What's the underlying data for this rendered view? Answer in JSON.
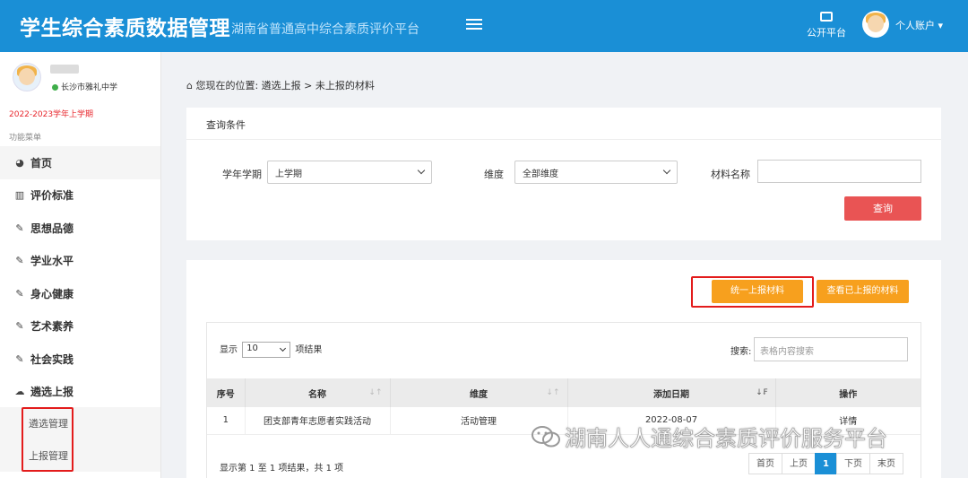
{
  "header": {
    "title": "学生综合素质数据管理",
    "subtitle": "湖南省普通高中综合素质评价平台",
    "public_label": "公开平台",
    "account_label": "个人账户"
  },
  "sidebar": {
    "school": "长沙市雅礼中学",
    "semester": "2022-2023学年上学期",
    "menu_title": "功能菜单",
    "items": [
      {
        "label": "首页",
        "icon": "dashboard-icon"
      },
      {
        "label": "评价标准",
        "icon": "map-icon"
      },
      {
        "label": "思想品德",
        "icon": "edit-icon"
      },
      {
        "label": "学业水平",
        "icon": "edit-icon"
      },
      {
        "label": "身心健康",
        "icon": "edit-icon"
      },
      {
        "label": "艺术素养",
        "icon": "edit-icon"
      },
      {
        "label": "社会实践",
        "icon": "edit-icon"
      },
      {
        "label": "遴选上报",
        "icon": "cloud-upload-icon"
      }
    ],
    "subitems": [
      {
        "label": "遴选管理"
      },
      {
        "label": "上报管理"
      }
    ]
  },
  "breadcrumb": "您现在的位置: 遴选上报 > 未上报的材料",
  "query": {
    "title": "查询条件",
    "term_label": "学年学期",
    "term_value": "上学期",
    "dimension_label": "维度",
    "dimension_value": "全部维度",
    "material_label": "材料名称",
    "material_value": "",
    "button": "查询"
  },
  "actions": {
    "submit_all": "统一上报材料",
    "view_submitted": "查看已上报的材料"
  },
  "table": {
    "show_prefix": "显示",
    "page_size": "10",
    "show_suffix": "项结果",
    "search_label": "搜索:",
    "search_placeholder": "表格内容搜索",
    "columns": [
      "序号",
      "名称",
      "维度",
      "添加日期",
      "操作"
    ],
    "rows": [
      {
        "index": "1",
        "name": "团支部青年志愿者实践活动",
        "dimension": "活动管理",
        "date": "2022-08-07",
        "action": "详情"
      }
    ],
    "info": "显示第 1 至 1 项结果，共 1 项",
    "pager": [
      "首页",
      "上页",
      "1",
      "下页",
      "末页"
    ]
  },
  "watermark": "湖南人人通综合素质评价服务平台"
}
